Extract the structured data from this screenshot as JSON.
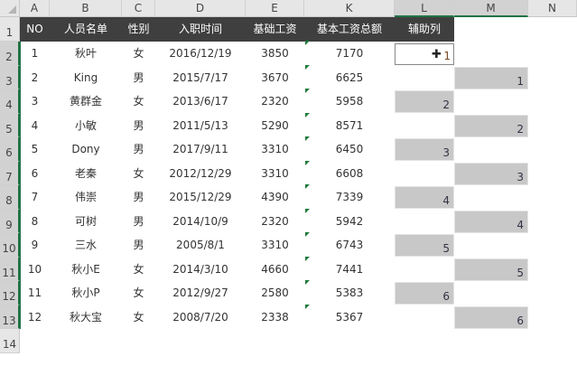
{
  "columns": [
    "A",
    "B",
    "C",
    "D",
    "E",
    "K",
    "L",
    "M",
    "N"
  ],
  "rows": [
    "1",
    "2",
    "3",
    "4",
    "5",
    "6",
    "7",
    "8",
    "9",
    "10",
    "11",
    "12",
    "13",
    "14"
  ],
  "headers": [
    "NO",
    "人员名单",
    "性别",
    "入职时间",
    "基础工资",
    "基本工资总额",
    "辅助列"
  ],
  "table": [
    [
      "1",
      "秋叶",
      "女",
      "2016/12/19",
      "3850",
      "7170"
    ],
    [
      "2",
      "King",
      "男",
      "2015/7/17",
      "3670",
      "6625"
    ],
    [
      "3",
      "黄群金",
      "女",
      "2013/6/17",
      "2320",
      "5958"
    ],
    [
      "4",
      "小敏",
      "男",
      "2011/5/13",
      "5290",
      "8571"
    ],
    [
      "5",
      "Dony",
      "男",
      "2017/9/11",
      "3310",
      "6450"
    ],
    [
      "6",
      "老秦",
      "女",
      "2012/12/29",
      "3310",
      "6608"
    ],
    [
      "7",
      "伟崇",
      "男",
      "2015/12/29",
      "4390",
      "7339"
    ],
    [
      "8",
      "可树",
      "男",
      "2014/10/9",
      "2320",
      "5942"
    ],
    [
      "9",
      "三水",
      "男",
      "2005/8/1",
      "3310",
      "6743"
    ],
    [
      "10",
      "秋小E",
      "女",
      "2014/3/10",
      "4660",
      "7441"
    ],
    [
      "11",
      "秋小P",
      "女",
      "2012/9/27",
      "2580",
      "5383"
    ],
    [
      "12",
      "秋大宝",
      "女",
      "2008/7/20",
      "2338",
      "5367"
    ]
  ],
  "selected_cell_value": "1",
  "helper_L": [
    "2",
    "3",
    "4",
    "5",
    "6"
  ],
  "helper_M": [
    "1",
    "2",
    "3",
    "4",
    "5",
    "6"
  ],
  "colors": {
    "header_bg": "#3f3f3f",
    "helper_fill": "#c8c8c8",
    "error_triangle": "#1e7a3a"
  }
}
